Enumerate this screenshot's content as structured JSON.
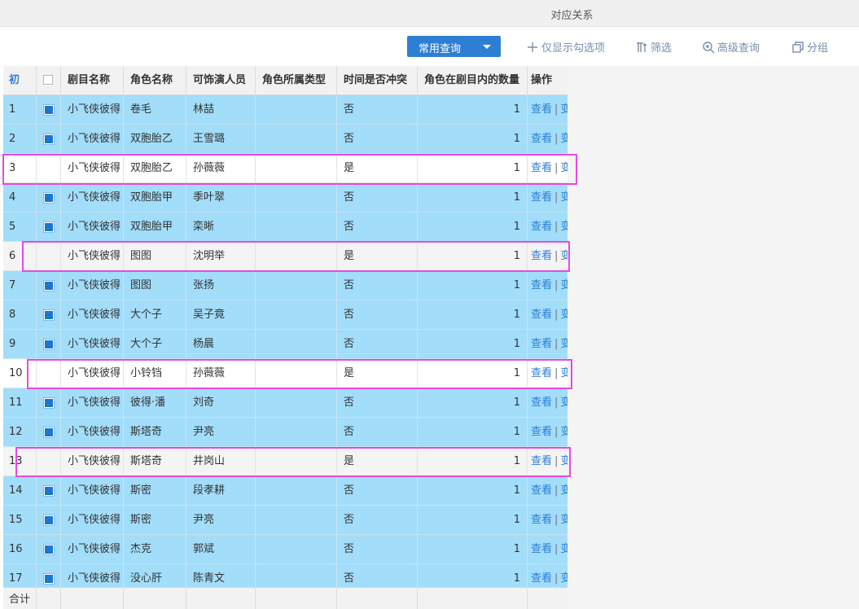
{
  "window": {
    "title": "对应关系"
  },
  "toolbar": {
    "common_query": "常用查询",
    "show_checked": "仅显示勾选项",
    "filter": "筛选",
    "advanced_query": "高级查询",
    "group": "分组"
  },
  "table": {
    "headers": {
      "idx": "初",
      "play": "剧目名称",
      "role": "角色名称",
      "actor": "可饰演人员",
      "type": "角色所属类型",
      "conflict": "时间是否冲突",
      "qty": "角色在剧目内的数量",
      "ops": "操作"
    },
    "ops": {
      "view": "查看",
      "sep": "|",
      "edit": "变"
    },
    "rows": [
      {
        "idx": "1",
        "checked": true,
        "play": "小飞侠彼得",
        "role": "卷毛",
        "actor": "林喆",
        "type": "",
        "conflict": "否",
        "qty": "1"
      },
      {
        "idx": "2",
        "checked": true,
        "play": "小飞侠彼得",
        "role": "双胞胎乙",
        "actor": "王雪璐",
        "type": "",
        "conflict": "否",
        "qty": "1"
      },
      {
        "idx": "3",
        "checked": false,
        "play": "小飞侠彼得",
        "role": "双胞胎乙",
        "actor": "孙薇薇",
        "type": "",
        "conflict": "是",
        "qty": "1"
      },
      {
        "idx": "4",
        "checked": true,
        "play": "小飞侠彼得",
        "role": "双胞胎甲",
        "actor": "季叶翠",
        "type": "",
        "conflict": "否",
        "qty": "1"
      },
      {
        "idx": "5",
        "checked": true,
        "play": "小飞侠彼得",
        "role": "双胞胎甲",
        "actor": "栾晰",
        "type": "",
        "conflict": "否",
        "qty": "1"
      },
      {
        "idx": "6",
        "checked": false,
        "play": "小飞侠彼得",
        "role": "图图",
        "actor": "沈明举",
        "type": "",
        "conflict": "是",
        "qty": "1"
      },
      {
        "idx": "7",
        "checked": true,
        "play": "小飞侠彼得",
        "role": "图图",
        "actor": "张扬",
        "type": "",
        "conflict": "否",
        "qty": "1"
      },
      {
        "idx": "8",
        "checked": true,
        "play": "小飞侠彼得",
        "role": "大个子",
        "actor": "吴子竟",
        "type": "",
        "conflict": "否",
        "qty": "1"
      },
      {
        "idx": "9",
        "checked": true,
        "play": "小飞侠彼得",
        "role": "大个子",
        "actor": "杨晨",
        "type": "",
        "conflict": "否",
        "qty": "1"
      },
      {
        "idx": "10",
        "checked": false,
        "play": "小飞侠彼得",
        "role": "小铃铛",
        "actor": "孙薇薇",
        "type": "",
        "conflict": "是",
        "qty": "1"
      },
      {
        "idx": "11",
        "checked": true,
        "play": "小飞侠彼得",
        "role": "彼得·潘",
        "actor": "刘奇",
        "type": "",
        "conflict": "否",
        "qty": "1"
      },
      {
        "idx": "12",
        "checked": true,
        "play": "小飞侠彼得",
        "role": "斯塔奇",
        "actor": "尹亮",
        "type": "",
        "conflict": "否",
        "qty": "1"
      },
      {
        "idx": "13",
        "checked": false,
        "play": "小飞侠彼得",
        "role": "斯塔奇",
        "actor": "井岗山",
        "type": "",
        "conflict": "是",
        "qty": "1"
      },
      {
        "idx": "14",
        "checked": true,
        "play": "小飞侠彼得",
        "role": "斯密",
        "actor": "段孝耕",
        "type": "",
        "conflict": "否",
        "qty": "1"
      },
      {
        "idx": "15",
        "checked": true,
        "play": "小飞侠彼得",
        "role": "斯密",
        "actor": "尹亮",
        "type": "",
        "conflict": "否",
        "qty": "1"
      },
      {
        "idx": "16",
        "checked": true,
        "play": "小飞侠彼得",
        "role": "杰克",
        "actor": "郭斌",
        "type": "",
        "conflict": "否",
        "qty": "1"
      },
      {
        "idx": "17",
        "checked": true,
        "play": "小飞侠彼得",
        "role": "没心肝",
        "actor": "陈青文",
        "type": "",
        "conflict": "否",
        "qty": "1"
      }
    ],
    "footer": {
      "total_label": "合计"
    }
  },
  "colors": {
    "accent": "#2e7fd4",
    "selected_row": "#a2ddfa",
    "highlight": "#e44ae4"
  }
}
